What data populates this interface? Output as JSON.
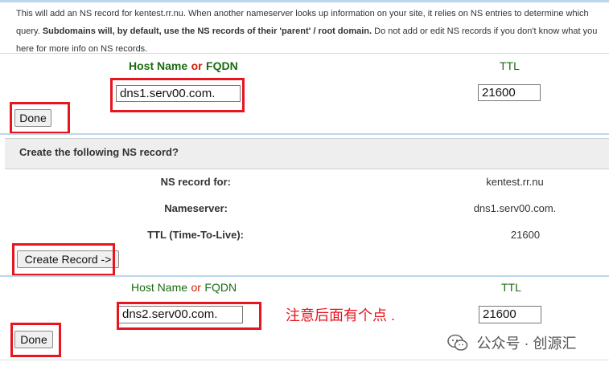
{
  "intro": {
    "line1": "This will add an NS record for kentest.rr.nu. When another nameserver looks up information on your site, it relies on NS entries to determine which",
    "line2_start": "query.",
    "line2_bold": "Subdomains will, by default, use the NS records of their 'parent' / root domain.",
    "line2_end": "Do not add or edit NS records if you don't know what you",
    "line3": "here for more info on NS records."
  },
  "form1": {
    "host_label_a": "Host Name",
    "host_label_or": "or",
    "host_label_b": "FQDN",
    "ttl_label": "TTL",
    "host_value": "dns1.serv00.com.",
    "ttl_value": "21600",
    "done_label": "Done"
  },
  "confirm": {
    "title": "Create the following NS record?",
    "rows": [
      {
        "label": "NS record for:",
        "value": "kentest.rr.nu"
      },
      {
        "label": "Nameserver:",
        "value": "dns1.serv00.com."
      },
      {
        "label": "TTL (Time-To-Live):",
        "value": "21600"
      }
    ],
    "create_label": "Create Record ->"
  },
  "form2": {
    "host_label_a": "Host Name",
    "host_label_or": "or",
    "host_label_b": "FQDN",
    "ttl_label": "TTL",
    "host_value": "dns2.serv00.com.",
    "ttl_value": "21600",
    "done_label": "Done"
  },
  "annotation": "注意后面有个点 .",
  "watermark": "公众号 · 创源汇",
  "colors": {
    "highlight": "#e8141e",
    "label_green": "#1a6b12",
    "or_red": "#cc2200"
  }
}
